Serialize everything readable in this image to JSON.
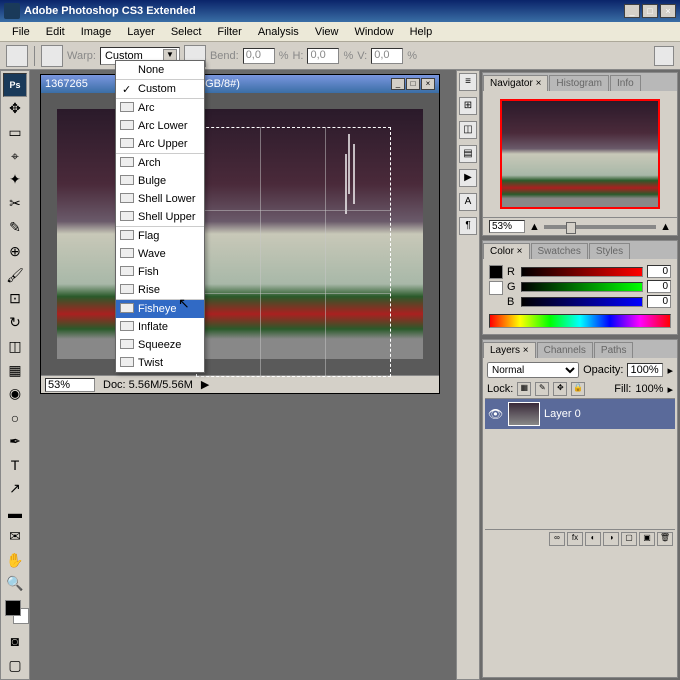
{
  "app": {
    "title": "Adobe Photoshop CS3 Extended"
  },
  "menu": [
    "File",
    "Edit",
    "Image",
    "Layer",
    "Select",
    "Filter",
    "Analysis",
    "View",
    "Window",
    "Help"
  ],
  "options": {
    "warp_label": "Warp:",
    "warp_value": "Custom",
    "bend_label": "Bend:",
    "bend_value": "0,0",
    "h_label": "H:",
    "h_value": "0,0",
    "v_label": "V:",
    "v_value": "0,0",
    "pct": "%"
  },
  "warp_menu": {
    "none": "None",
    "custom": "Custom",
    "arc": "Arc",
    "arc_lower": "Arc Lower",
    "arc_upper": "Arc Upper",
    "arch": "Arch",
    "bulge": "Bulge",
    "shell_lower": "Shell Lower",
    "shell_upper": "Shell Upper",
    "flag": "Flag",
    "wave": "Wave",
    "fish": "Fish",
    "rise": "Rise",
    "fisheye": "Fisheye",
    "inflate": "Inflate",
    "squeeze": "Squeeze",
    "twist": "Twist"
  },
  "document": {
    "title_prefix": "1367265",
    "title_suffix": "% (Layer 0, RGB/8#)",
    "zoom": "53%",
    "info": "Doc: 5.56M/5.56M"
  },
  "navigator": {
    "tabs": [
      "Navigator ×",
      "Histogram",
      "Info"
    ],
    "zoom": "53%"
  },
  "color": {
    "tabs": [
      "Color ×",
      "Swatches",
      "Styles"
    ],
    "r": "R",
    "g": "G",
    "b": "B",
    "rv": "0",
    "gv": "0",
    "bv": "0"
  },
  "layers": {
    "tabs": [
      "Layers ×",
      "Channels",
      "Paths"
    ],
    "blend": "Normal",
    "opacity_label": "Opacity:",
    "opacity": "100%",
    "lock_label": "Lock:",
    "fill_label": "Fill:",
    "fill": "100%",
    "layer0": "Layer 0"
  }
}
